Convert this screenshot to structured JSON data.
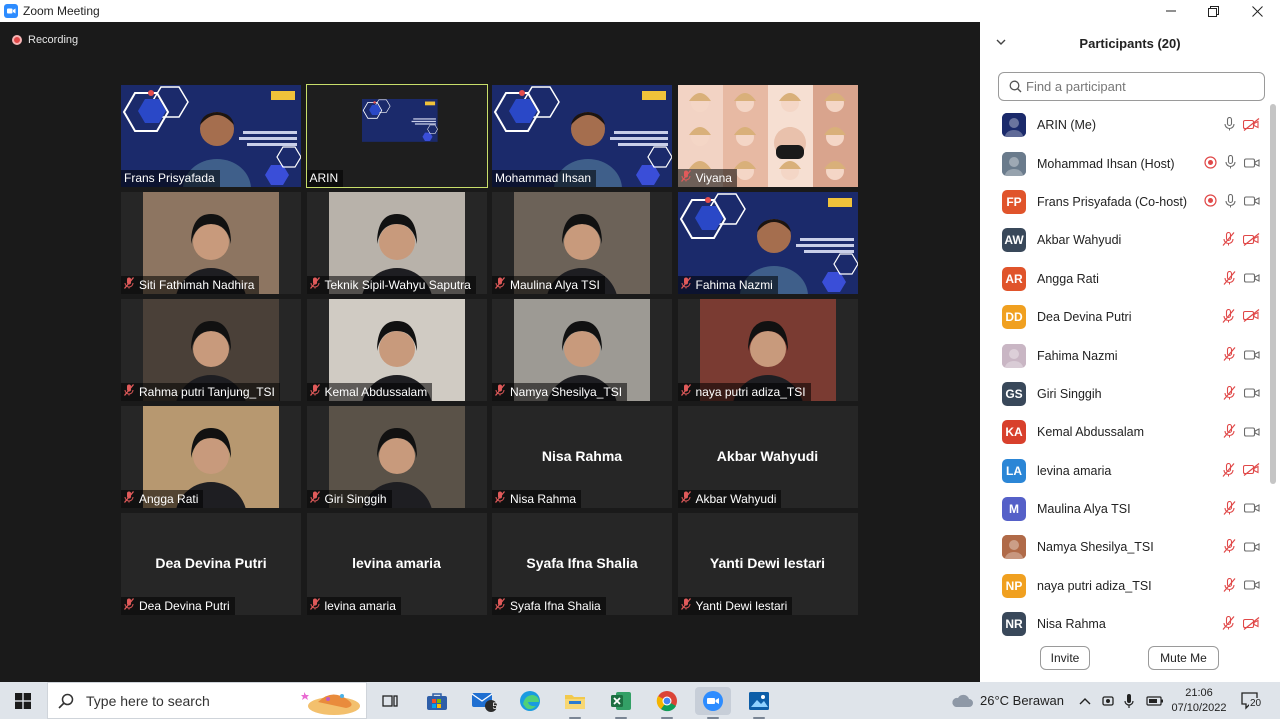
{
  "window": {
    "title": "Zoom Meeting"
  },
  "recording": {
    "label": "Recording"
  },
  "tiles": [
    {
      "name": "Frans Prisyafada",
      "kind": "slide-person",
      "muted": false,
      "active": false
    },
    {
      "name": "ARIN",
      "kind": "slide",
      "muted": false,
      "active": true
    },
    {
      "name": "Mohammad Ihsan",
      "kind": "slide-person",
      "muted": false,
      "active": false
    },
    {
      "name": "Viyana",
      "kind": "collage",
      "muted": true,
      "active": false
    },
    {
      "name": "Siti Fathimah Nadhira",
      "kind": "camera",
      "muted": true,
      "active": false
    },
    {
      "name": "Teknik Sipil-Wahyu Saputra",
      "kind": "camera",
      "muted": true,
      "active": false
    },
    {
      "name": "Maulina Alya TSI",
      "kind": "camera",
      "muted": true,
      "active": false
    },
    {
      "name": "Fahima Nazmi",
      "kind": "slide-person",
      "muted": true,
      "active": false
    },
    {
      "name": "Rahma putri Tanjung_TSI",
      "kind": "camera",
      "muted": true,
      "active": false
    },
    {
      "name": "Kemal Abdussalam",
      "kind": "camera",
      "muted": true,
      "active": false
    },
    {
      "name": "Namya Shesilya_TSI",
      "kind": "camera",
      "muted": true,
      "active": false
    },
    {
      "name": "naya putri adiza_TSI",
      "kind": "camera",
      "muted": true,
      "active": false
    },
    {
      "name": "Angga Rati",
      "kind": "camera",
      "muted": true,
      "active": false
    },
    {
      "name": "Giri Singgih",
      "kind": "camera",
      "muted": true,
      "active": false
    },
    {
      "name": "Nisa Rahma",
      "kind": "name",
      "muted": true,
      "active": false
    },
    {
      "name": "Akbar Wahyudi",
      "kind": "name",
      "muted": true,
      "active": false
    },
    {
      "name": "Dea Devina Putri",
      "kind": "name",
      "muted": true,
      "active": false
    },
    {
      "name": "levina amaria",
      "kind": "name",
      "muted": true,
      "active": false
    },
    {
      "name": "Syafa Ifna Shalia",
      "kind": "name",
      "muted": true,
      "active": false
    },
    {
      "name": "Yanti Dewi lestari",
      "kind": "name",
      "muted": true,
      "active": false
    }
  ],
  "participants": {
    "title": "Participants (20)",
    "search_placeholder": "Find a participant",
    "invite_label": "Invite",
    "mute_me_label": "Mute Me",
    "items": [
      {
        "name": "ARIN (Me)",
        "initials": "",
        "color": "#1b2a6b",
        "photo": true,
        "rec": false,
        "mic": "on",
        "video": "off"
      },
      {
        "name": "Mohammad Ihsan (Host)",
        "initials": "",
        "color": "#6a7b8c",
        "photo": true,
        "rec": true,
        "mic": "on",
        "video": "on"
      },
      {
        "name": "Frans Prisyafada (Co-host)",
        "initials": "FP",
        "color": "#e0542b",
        "photo": false,
        "rec": true,
        "mic": "on",
        "video": "on"
      },
      {
        "name": "Akbar Wahyudi",
        "initials": "AW",
        "color": "#39485a",
        "photo": false,
        "rec": false,
        "mic": "off",
        "video": "off"
      },
      {
        "name": "Angga Rati",
        "initials": "AR",
        "color": "#e0542b",
        "photo": false,
        "rec": false,
        "mic": "off",
        "video": "on"
      },
      {
        "name": "Dea Devina Putri",
        "initials": "DD",
        "color": "#f0a020",
        "photo": false,
        "rec": false,
        "mic": "off",
        "video": "off"
      },
      {
        "name": "Fahima Nazmi",
        "initials": "",
        "color": "#c9b6c4",
        "photo": true,
        "rec": false,
        "mic": "off",
        "video": "on"
      },
      {
        "name": "Giri Singgih",
        "initials": "GS",
        "color": "#39485a",
        "photo": false,
        "rec": false,
        "mic": "off",
        "video": "on"
      },
      {
        "name": "Kemal Abdussalam",
        "initials": "KA",
        "color": "#d8402c",
        "photo": false,
        "rec": false,
        "mic": "off",
        "video": "on"
      },
      {
        "name": "levina amaria",
        "initials": "LA",
        "color": "#2b86d6",
        "photo": false,
        "rec": false,
        "mic": "off",
        "video": "off"
      },
      {
        "name": "Maulina Alya TSI",
        "initials": "M",
        "color": "#5560c8",
        "photo": false,
        "rec": false,
        "mic": "off",
        "video": "on"
      },
      {
        "name": "Namya Shesilya_TSI",
        "initials": "",
        "color": "#b06a48",
        "photo": true,
        "rec": false,
        "mic": "off",
        "video": "on"
      },
      {
        "name": "naya putri adiza_TSI",
        "initials": "NP",
        "color": "#f0a020",
        "photo": false,
        "rec": false,
        "mic": "off",
        "video": "on"
      },
      {
        "name": "Nisa Rahma",
        "initials": "NR",
        "color": "#39485a",
        "photo": false,
        "rec": false,
        "mic": "off",
        "video": "off"
      }
    ]
  },
  "taskbar": {
    "search_placeholder": "Type here to search",
    "mail_badge": "5",
    "weather": "26°C Berawan",
    "time": "21:06",
    "date": "07/10/2022",
    "notification_count": "20"
  }
}
